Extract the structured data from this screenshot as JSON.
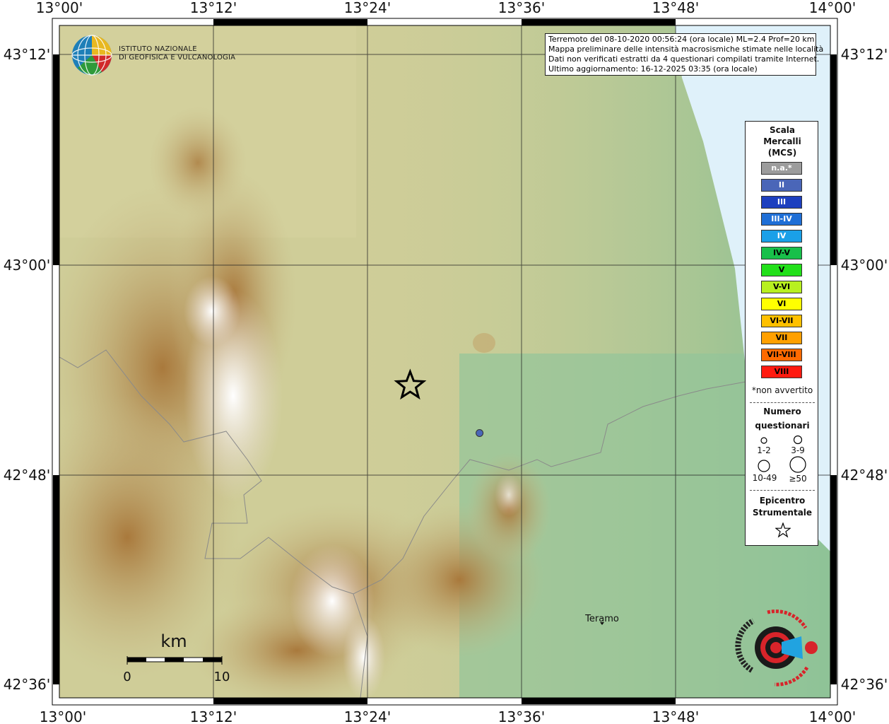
{
  "info": {
    "line1": "Terremoto del 08-10-2020 00:56:24 (ora locale) ML=2.4 Prof=20 km",
    "line2": "Mappa preliminare delle intensità macrosismiche stimate nelle località",
    "line3": "Dati non verificati estratti da 4 questionari compilati tramite Internet.",
    "line4": "Ultimo aggiornamento: 16-12-2025 03:35 (ora locale)"
  },
  "axes": {
    "lon_ticks": [
      "13°00'",
      "13°12'",
      "13°24'",
      "13°36'",
      "13°48'",
      "14°00'"
    ],
    "lat_ticks": [
      "43°12'",
      "43°00'",
      "42°48'",
      "42°36'"
    ]
  },
  "institute": {
    "line1": "ISTITUTO NAZIONALE",
    "line2": "DI GEOFISICA E VULCANOLOGIA"
  },
  "legend": {
    "title1": "Scala",
    "title2": "Mercalli",
    "title3": "(MCS)",
    "classes": [
      {
        "label": "n.a.*",
        "color": "#9c9c9c",
        "text": "#ffffff"
      },
      {
        "label": "II",
        "color": "#4a66b8",
        "text": "#ffffff"
      },
      {
        "label": "III",
        "color": "#1d3fbf",
        "text": "#ffffff"
      },
      {
        "label": "III-IV",
        "color": "#1f6fd6",
        "text": "#ffffff"
      },
      {
        "label": "IV",
        "color": "#1aa0e8",
        "text": "#ffffff"
      },
      {
        "label": "IV-V",
        "color": "#18c04a",
        "text": "#000000"
      },
      {
        "label": "V",
        "color": "#22e01a",
        "text": "#000000"
      },
      {
        "label": "V-VI",
        "color": "#b8f020",
        "text": "#000000"
      },
      {
        "label": "VI",
        "color": "#ffff00",
        "text": "#000000"
      },
      {
        "label": "VI-VII",
        "color": "#ffc000",
        "text": "#000000"
      },
      {
        "label": "VII",
        "color": "#ffa000",
        "text": "#000000"
      },
      {
        "label": "VII-VIII",
        "color": "#ff6a00",
        "text": "#000000"
      },
      {
        "label": "VIII",
        "color": "#ff1a10",
        "text": "#000000"
      }
    ],
    "note": "*non avvertito",
    "count_title1": "Numero",
    "count_title2": "questionari",
    "count_1_2": "1-2",
    "count_3_9": "3-9",
    "count_10_49": "10-49",
    "count_50": "≥50",
    "epi_title1": "Epicentro",
    "epi_title2": "Strumentale"
  },
  "place": {
    "name": "Teramo"
  },
  "scalebar": {
    "unit": "km",
    "start": "0",
    "end": "10"
  },
  "observations": [
    {
      "lon": 13.545,
      "lat": 42.84,
      "intensity": "II",
      "count": "1-2"
    }
  ],
  "epicenter": {
    "lon": 13.455,
    "lat": 42.885
  },
  "colors": {
    "sea": "#dff1fa",
    "lowland": "#8fc49b",
    "hills": "#c8c791",
    "mountains": "#b58a4a",
    "peaks": "#f4f2f4"
  }
}
